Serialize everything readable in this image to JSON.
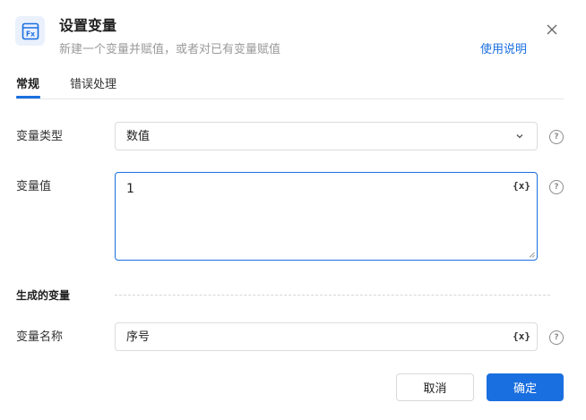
{
  "header": {
    "title": "设置变量",
    "subtitle": "新建一个变量并赋值，或者对已有变量赋值",
    "help_link": "使用说明",
    "icon_name": "function-fx-icon",
    "icon_text": "Fx"
  },
  "tabs": [
    {
      "label": "常规",
      "active": true
    },
    {
      "label": "错误处理",
      "active": false
    }
  ],
  "form": {
    "variable_type": {
      "label": "变量类型",
      "value": "数值"
    },
    "variable_value": {
      "label": "变量值",
      "value": "1",
      "fx": "{x}"
    },
    "section_title": "生成的变量",
    "variable_name": {
      "label": "变量名称",
      "value": "序号",
      "fx": "{x}"
    },
    "help_glyph": "?"
  },
  "footer": {
    "cancel_label": "取消",
    "ok_label": "确定"
  },
  "colors": {
    "accent": "#1a6fe0",
    "icon_bg": "#eaf1fd"
  }
}
